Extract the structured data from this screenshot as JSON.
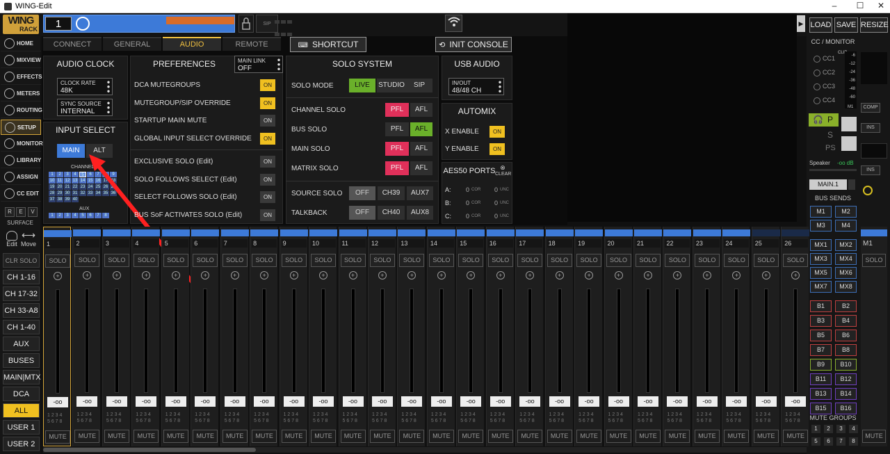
{
  "window": {
    "title": "WING-Edit",
    "min": "–",
    "max": "☐",
    "close": "✕"
  },
  "logo": {
    "main": "WING",
    "sub": "RACK"
  },
  "channel": {
    "number": "1",
    "sip": "SIP"
  },
  "nav": [
    "HOME",
    "MIXVIEW",
    "EFFECTS",
    "METERS",
    "ROUTING",
    "SETUP",
    "MONITOR",
    "LIBRARY",
    "ASSIGN",
    "CC EDIT"
  ],
  "nav_active": "SETUP",
  "rev": [
    "R",
    "E",
    "V"
  ],
  "surface": {
    "label": "SURFACE",
    "edit": "Edit",
    "move": "Move"
  },
  "layers": [
    "CLR SOLO",
    "CH 1-16",
    "CH 17-32",
    "CH 33-A8",
    "CH 1-40",
    "AUX",
    "BUSES",
    "MAIN|MTX",
    "DCA",
    "ALL",
    "USER 1",
    "USER 2"
  ],
  "layer_active": "ALL",
  "tabs": [
    "CONNECT",
    "GENERAL",
    "AUDIO",
    "REMOTE"
  ],
  "tab_active": "AUDIO",
  "shortcut_keys": "SHORTCUT KEYS",
  "init_console": "INIT CONSOLE",
  "audio_clock": {
    "title": "AUDIO CLOCK",
    "clock_rate_label": "CLOCK RATE",
    "clock_rate": "48K",
    "sync_source_label": "SYNC SOURCE",
    "sync_source": "INTERNAL"
  },
  "input_select": {
    "title": "INPUT SELECT",
    "main": "MAIN",
    "alt": "ALT",
    "channels_label": "CHANNELS",
    "aux_label": "AUX"
  },
  "preferences": {
    "title": "PREFERENCES",
    "main_link_label": "MAIN LINK",
    "main_link": "OFF",
    "items": [
      {
        "label": "DCA MUTEGROUPS",
        "state": "ON",
        "active": true
      },
      {
        "label": "MUTEGROUP/SIP OVERRIDE",
        "state": "ON",
        "active": true
      },
      {
        "label": "STARTUP MAIN MUTE",
        "state": "ON",
        "active": false
      },
      {
        "label": "GLOBAL INPUT SELECT OVERRIDE",
        "state": "ON",
        "active": true
      },
      {
        "label": "EXCLUSIVE SOLO (Edit)",
        "state": "ON",
        "active": false
      },
      {
        "label": "SOLO FOLLOWS SELECT (Edit)",
        "state": "ON",
        "active": false
      },
      {
        "label": "SELECT FOLLOWS SOLO (Edit)",
        "state": "ON",
        "active": false
      },
      {
        "label": "BUS SoF ACTIVATES SOLO (Edit)",
        "state": "ON",
        "active": false
      }
    ]
  },
  "solo_system": {
    "title": "SOLO SYSTEM",
    "mode_label": "SOLO MODE",
    "modes": [
      "LIVE",
      "STUDIO",
      "SIP"
    ],
    "mode_active": "LIVE",
    "rows": [
      {
        "label": "CHANNEL SOLO",
        "pfl": "PFL",
        "afl": "AFL",
        "active": "PFL"
      },
      {
        "label": "BUS SOLO",
        "pfl": "PFL",
        "afl": "AFL",
        "active": "AFL"
      },
      {
        "label": "MAIN SOLO",
        "pfl": "PFL",
        "afl": "AFL",
        "active": "PFL"
      },
      {
        "label": "MATRIX SOLO",
        "pfl": "PFL",
        "afl": "AFL",
        "active": "PFL"
      }
    ],
    "source_solo": {
      "label": "SOURCE SOLO",
      "opts": [
        "OFF",
        "CH39",
        "AUX7"
      ]
    },
    "talkback": {
      "label": "TALKBACK",
      "opts": [
        "OFF",
        "CH40",
        "AUX8"
      ]
    }
  },
  "usb_audio": {
    "title": "USB AUDIO",
    "inout_label": "IN/OUT",
    "inout": "48/48 CH"
  },
  "automix": {
    "title": "AUTOMIX",
    "x_label": "X ENABLE",
    "y_label": "Y ENABLE",
    "x": "ON",
    "y": "ON"
  },
  "aes50": {
    "title": "AES50 PORTS",
    "clear": "CLEAR",
    "ports": [
      {
        "name": "A:",
        "cor": "0",
        "corl": "COR",
        "unc": "0",
        "uncl": "UNC"
      },
      {
        "name": "B:",
        "cor": "0",
        "corl": "COR",
        "unc": "0",
        "uncl": "UNC"
      },
      {
        "name": "C:",
        "cor": "0",
        "corl": "COR",
        "unc": "0",
        "uncl": "UNC"
      }
    ]
  },
  "strip": {
    "solo": "SOLO",
    "mute": "MUTE",
    "fader": "-oo",
    "plus": "+",
    "groups1": "1 2 3 4",
    "groups2": "5 6 7 8"
  },
  "channels": [
    "1",
    "2",
    "3",
    "4",
    "5",
    "6",
    "7",
    "8",
    "9",
    "10",
    "11",
    "12",
    "13",
    "14",
    "15",
    "16",
    "17",
    "18",
    "19",
    "20",
    "21",
    "22",
    "23",
    "24",
    "25",
    "26"
  ],
  "m1": {
    "name": "M1",
    "solo": "SOLO",
    "mute": "MUTE"
  },
  "right": {
    "load": "LOAD",
    "save": "SAVE",
    "resize": "RESIZE",
    "cc_monitor": "CC / MONITOR",
    "cc": [
      "CC1",
      "CC2",
      "CC3",
      "CC4"
    ],
    "clip": "CLIP",
    "scale": [
      "-6",
      "-12",
      "-24",
      "-36",
      "-48",
      "-60"
    ],
    "meter_label": "M1",
    "p": "P",
    "s": "S",
    "ps": "PS",
    "speaker_label": "Speaker",
    "speaker_value": "-oo dB",
    "main_sel": "MAIN.1",
    "bus_sends": "BUS SENDS",
    "mains": [
      "M1",
      "M2",
      "M3",
      "M4"
    ],
    "mtx": [
      "MX1",
      "MX2",
      "MX3",
      "MX4",
      "MX5",
      "MX6",
      "MX7",
      "MX8"
    ],
    "buses": [
      "B1",
      "B2",
      "B3",
      "B4",
      "B5",
      "B6",
      "B7",
      "B8",
      "B9",
      "B10",
      "B11",
      "B12",
      "B13",
      "B14",
      "B15",
      "B16"
    ],
    "mute_groups": "MUTE GROUPS",
    "mg": [
      "1",
      "2",
      "3",
      "4",
      "5",
      "6",
      "7",
      "8"
    ],
    "comp": "COMP",
    "ins": "INS",
    "ins2": "INS"
  },
  "colors": {
    "accent": "#f0c020",
    "blue": "#3d7ad8",
    "green": "#6ab02a",
    "red": "#e0305a",
    "arrow": "#ff2020"
  }
}
